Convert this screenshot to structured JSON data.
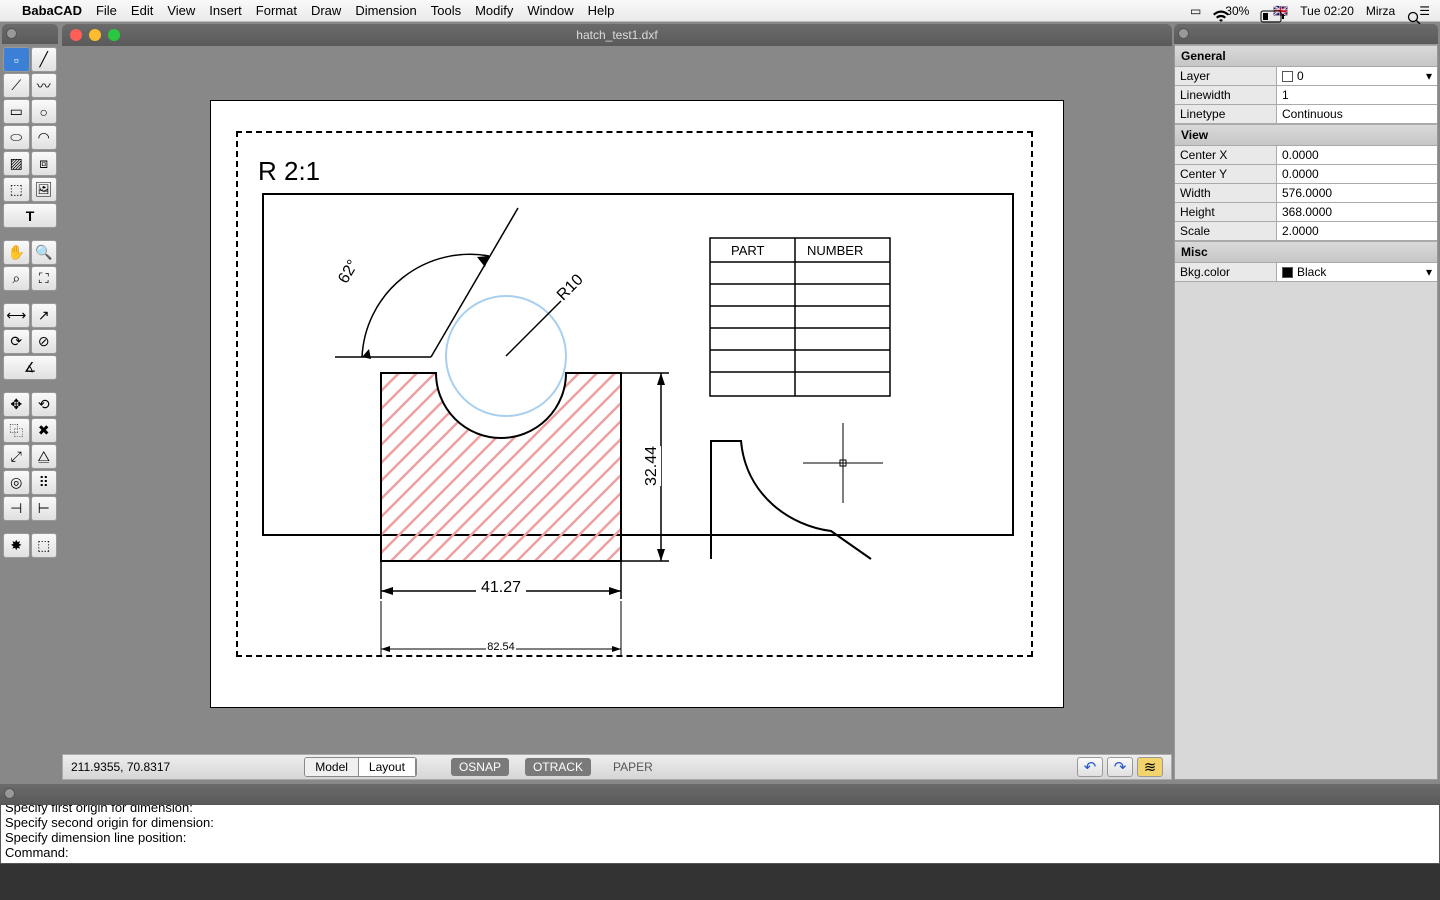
{
  "menubar": {
    "appname": "BabaCAD",
    "items": [
      "File",
      "Edit",
      "View",
      "Insert",
      "Format",
      "Draw",
      "Dimension",
      "Tools",
      "Modify",
      "Window",
      "Help"
    ],
    "battery": "30%",
    "clock": "Tue 02:20",
    "user": "Mirza",
    "flag": "🇬🇧"
  },
  "doc": {
    "title": "hatch_test1.dxf"
  },
  "drawing": {
    "scale_label": "R 2:1",
    "angle_dim": "62°",
    "radius_dim": "R10",
    "dim_h": "41.27",
    "dim_v": "32.44",
    "dim_h2": "82.54",
    "table_headers": [
      "PART",
      "NUMBER"
    ]
  },
  "status": {
    "coords": "211.9355, 70.8317",
    "tab_model": "Model",
    "tab_layout": "Layout",
    "osnap": "OSNAP",
    "otrack": "OTRACK",
    "paper": "PAPER"
  },
  "cmd": {
    "l0": "Specify first origin for dimension:",
    "l1": "Specify second origin for dimension:",
    "l2": "Specify dimension line position:",
    "l3": "Command:"
  },
  "props": {
    "general_h": "General",
    "layer_k": "Layer",
    "layer_v": "0",
    "lw_k": "Linewidth",
    "lw_v": "1",
    "lt_k": "Linetype",
    "lt_v": "Continuous",
    "view_h": "View",
    "cx_k": "Center X",
    "cx_v": "0.0000",
    "cy_k": "Center Y",
    "cy_v": "0.0000",
    "w_k": "Width",
    "w_v": "576.0000",
    "h_k": "Height",
    "h_v": "368.0000",
    "s_k": "Scale",
    "s_v": "2.0000",
    "misc_h": "Misc",
    "bg_k": "Bkg.color",
    "bg_v": "Black"
  }
}
